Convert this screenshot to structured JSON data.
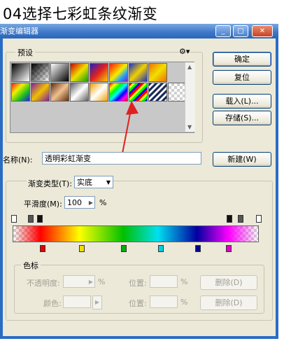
{
  "caption": "04选择七彩虹条纹渐变",
  "window": {
    "title": "渐变编辑器"
  },
  "title_buttons": {
    "minimize": "_",
    "maximize": "□",
    "close": "✕"
  },
  "presets": {
    "label": "预设"
  },
  "buttons": {
    "ok": "确定",
    "reset": "复位",
    "load": "载入(L)...",
    "save": "存储(S)...",
    "new": "新建(W)"
  },
  "name_field": {
    "label": "名称(N):",
    "value": "透明彩虹渐变"
  },
  "gradient_type": {
    "label": "渐变类型(T):",
    "value": "实底"
  },
  "smoothness": {
    "label": "平滑度(M):",
    "value": "100",
    "unit": "%"
  },
  "stops_group": {
    "label": "色标",
    "opacity_label": "不透明度:",
    "opacity_unit": "%",
    "location_label": "位置:",
    "location_unit": "%",
    "delete_label": "删除(D)",
    "color_label": "颜色:",
    "location_label2": "位置:",
    "location_unit2": "%",
    "delete_label2": "删除(D)"
  },
  "colors": {
    "accent": "#2a6cc4",
    "arrow": "#e02020",
    "stops": [
      "#e00000",
      "#f0e000",
      "#00b000",
      "#00d0e0",
      "#000090",
      "#e000c0"
    ]
  }
}
